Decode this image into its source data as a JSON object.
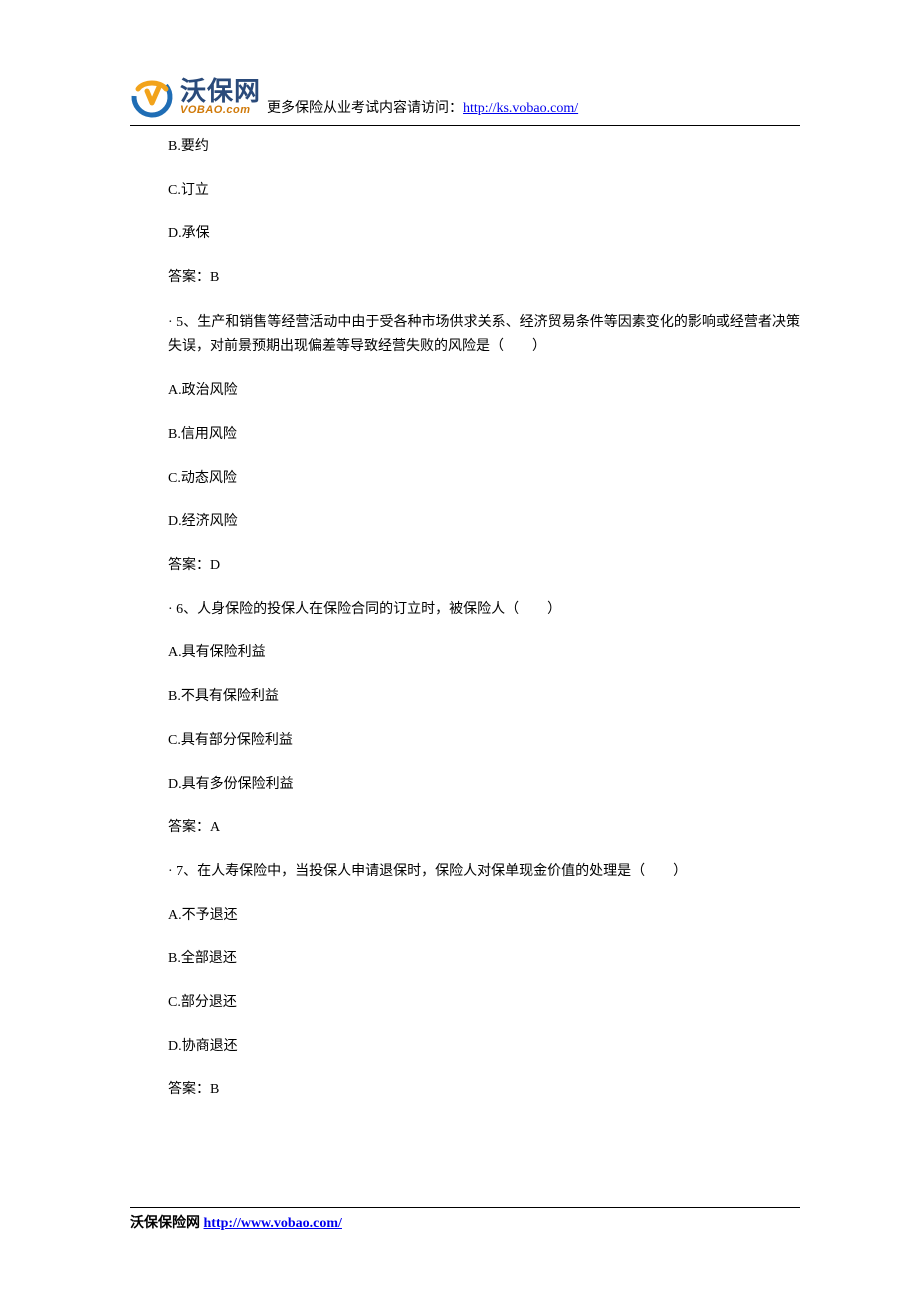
{
  "header": {
    "brand_cn": "沃保网",
    "brand_en": "VOBAO.com",
    "lead_text": "更多保险从业考试内容请访问：",
    "link_text": "http://ks.vobao.com/",
    "link_href": "http://ks.vobao.com/"
  },
  "content": {
    "q4_tail": {
      "opt_b": "B.要约",
      "opt_c": "C.订立",
      "opt_d": "D.承保",
      "answer": "答案：B"
    },
    "q5": {
      "stem": "· 5、生产和销售等经营活动中由于受各种市场供求关系、经济贸易条件等因素变化的影响或经营者决策失误，对前景预期出现偏差等导致经营失败的风险是（　　）",
      "opt_a": "A.政治风险",
      "opt_b": "B.信用风险",
      "opt_c": "C.动态风险",
      "opt_d": "D.经济风险",
      "answer": "答案：D"
    },
    "q6": {
      "stem": "· 6、人身保险的投保人在保险合同的订立时，被保险人（　　）",
      "opt_a": "A.具有保险利益",
      "opt_b": "B.不具有保险利益",
      "opt_c": "C.具有部分保险利益",
      "opt_d": "D.具有多份保险利益",
      "answer": "答案：A"
    },
    "q7": {
      "stem": "· 7、在人寿保险中，当投保人申请退保时，保险人对保单现金价值的处理是（　　）",
      "opt_a": "A.不予退还",
      "opt_b": "B.全部退还",
      "opt_c": "C.部分退还",
      "opt_d": "D.协商退还",
      "answer": "答案：B"
    }
  },
  "footer": {
    "site_name": "沃保保险网 ",
    "link_text": "http://www.vobao.com/",
    "link_href": "http://www.vobao.com/"
  }
}
